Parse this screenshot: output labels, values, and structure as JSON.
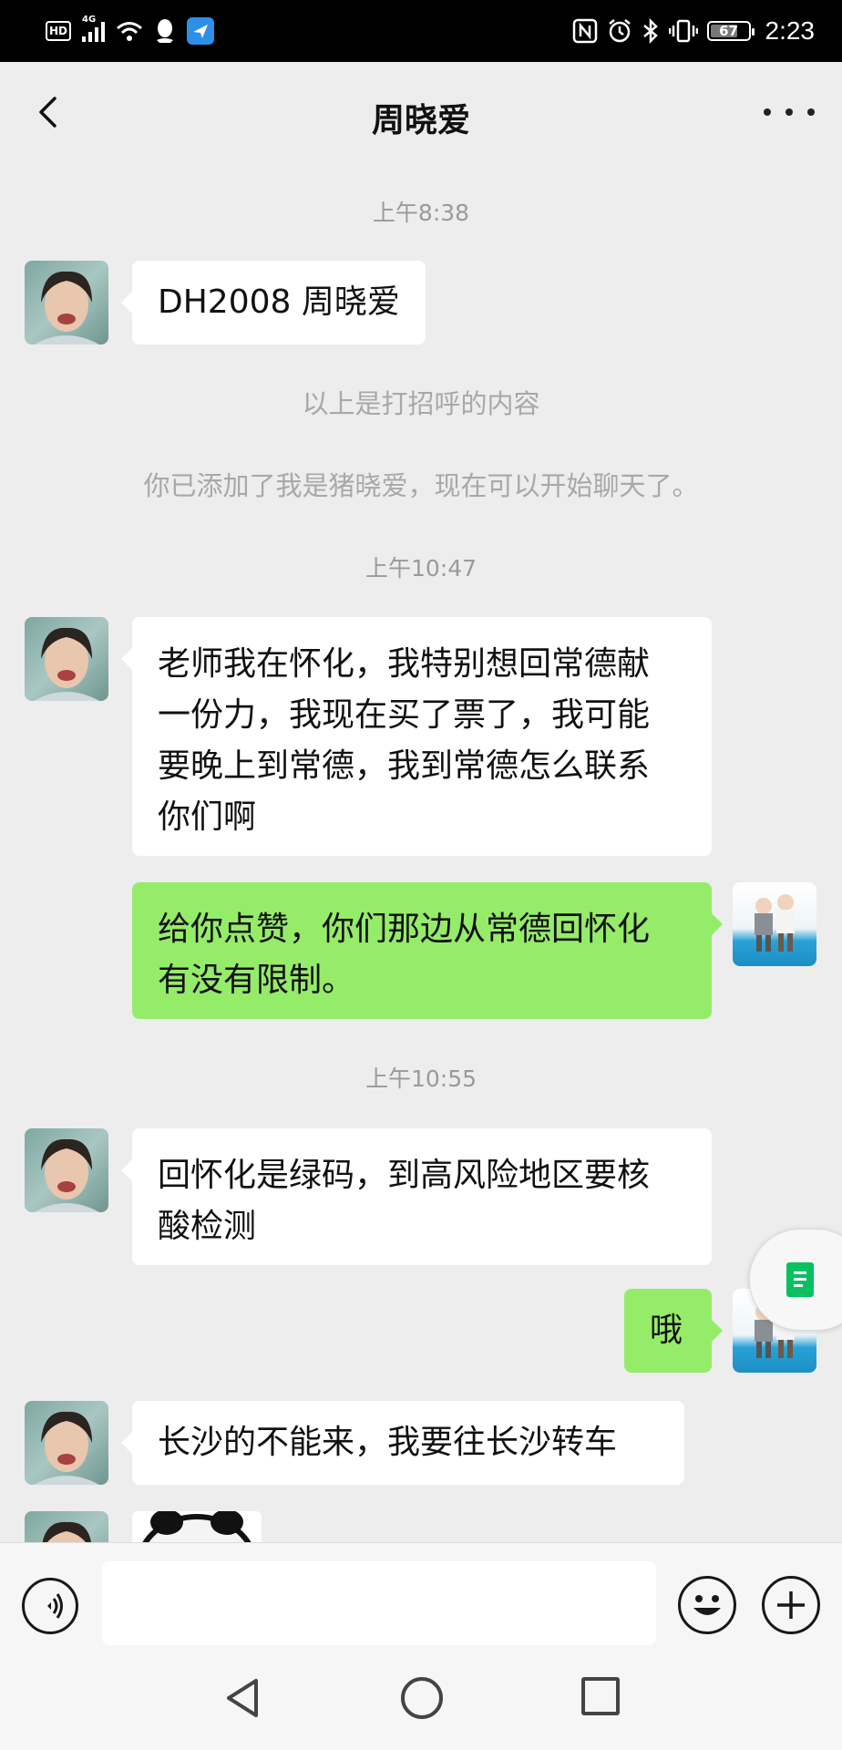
{
  "status_bar": {
    "hd": "HD",
    "network": "4G",
    "time": "2:23",
    "battery": "67",
    "battery_level": 0.67,
    "left_icons": [
      "hd-icon",
      "signal-icon",
      "wifi-icon",
      "qq-icon",
      "app-icon"
    ],
    "right_icons": [
      "nfc-icon",
      "alarm-icon",
      "bluetooth-icon",
      "vibrate-icon",
      "battery-icon"
    ]
  },
  "header": {
    "title": "周晓爱",
    "back_icon": "chevron-left-icon",
    "more_icon": "more-dots-icon"
  },
  "messages": {
    "t1": "上午8:38",
    "m1": "DH2008 周晓爱",
    "sys1": "以上是打招呼的内容",
    "sys2": "你已添加了我是猪晓爱，现在可以开始聊天了。",
    "t2": "上午10:47",
    "m2_lines": [
      "老师我在怀化，我特别想回常德献",
      "一份力，我现在买了票了，我可能",
      "要晚上到常德，我到常德怎么联系",
      "你们啊"
    ],
    "m3_lines": [
      "给你点赞，你们那边从常德回怀化",
      "有没有限制。"
    ],
    "t3": "上午10:55",
    "m4_lines": [
      "回怀化是绿码，到高风险地区要核",
      "酸检测"
    ],
    "m5": "哦",
    "m6": "长沙的不能来，我要往长沙转车"
  },
  "input_bar": {
    "placeholder": "",
    "voice_icon": "voice-icon",
    "emoji_icon": "emoji-icon",
    "plus_icon": "plus-icon"
  },
  "nav_bar": {
    "icons": [
      "nav-back-icon",
      "nav-home-icon",
      "nav-recent-icon"
    ]
  },
  "colors": {
    "sent_bubble": "#95ec69",
    "received_bubble": "#ffffff",
    "background": "#ededed",
    "accent": "#07c160"
  }
}
